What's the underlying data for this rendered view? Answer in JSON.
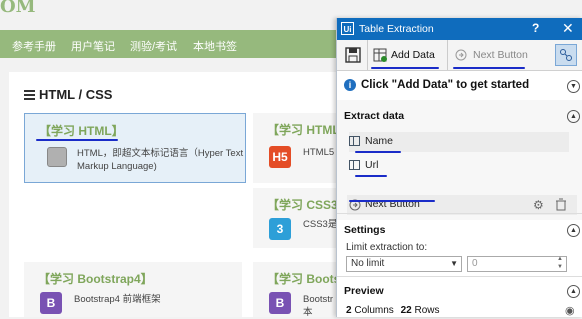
{
  "site": {
    "logo": "OM",
    "nav": [
      "参考手册",
      "用户笔记",
      "测验/考试",
      "本地书签"
    ],
    "section_title": "HTML / CSS",
    "cards": [
      {
        "title": "【学习 HTML】",
        "desc1": "HTML，即超文本标记语言（Hyper Text",
        "desc2": "Markup Language)"
      },
      {
        "title": "【学习 HTML",
        "desc1": "HTML5"
      },
      {
        "title": "【学习 CSS3",
        "desc1": "CSS3是"
      },
      {
        "title": "【学习 Bootstrap4】",
        "desc1": "Bootstrap4 前端框架"
      },
      {
        "title": "【学习 Boots",
        "desc1": "Bootstr",
        "desc2": "本"
      }
    ],
    "tiles": {
      "html_tile": "H5",
      "css3_tile": "3",
      "b4_tile": "B",
      "b5_tile": "B"
    }
  },
  "panel": {
    "title": "Table Extraction",
    "logo": "Ui",
    "help": "?",
    "close": "✕",
    "toolbar": {
      "add_data": "Add Data",
      "next_button": "Next Button"
    },
    "hint": "Click \"Add Data\" to get started",
    "extract": {
      "header": "Extract data",
      "fields": [
        "Name",
        "Url"
      ],
      "next_button": "Next Button"
    },
    "settings": {
      "header": "Settings",
      "limit_label": "Limit extraction to:",
      "limit_value": "No limit",
      "limit_number": "0"
    },
    "preview": {
      "header": "Preview",
      "columns": "2",
      "columns_label": "Columns",
      "rows": "22",
      "rows_label": "Rows"
    }
  },
  "colors": {
    "accent": "#0f6cbd",
    "site_green": "#96b97d",
    "annotation": "#1a2cc8"
  }
}
